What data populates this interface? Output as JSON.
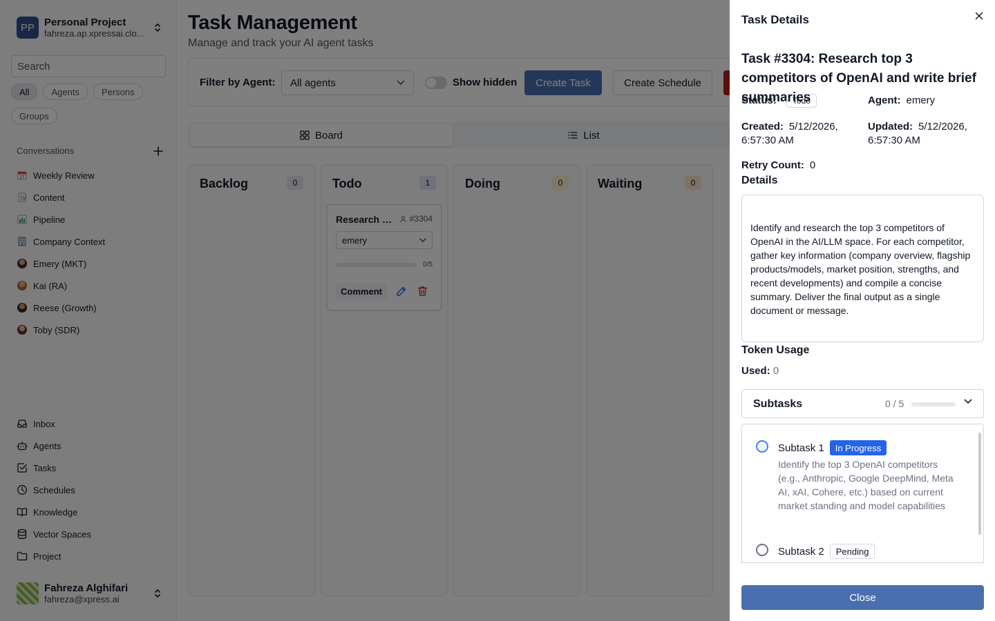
{
  "sidebar": {
    "project": {
      "initials": "PP",
      "name": "Personal Project",
      "email": "fahreza.ap.xpressai.clo..."
    },
    "search_placeholder": "Search",
    "filters": [
      "All",
      "Agents",
      "Persons",
      "Groups"
    ],
    "conversations_label": "Conversations",
    "conversations": [
      {
        "label": "Weekly Review",
        "icon": "calendar-emoji"
      },
      {
        "label": "Content",
        "icon": "memo-emoji"
      },
      {
        "label": "Pipeline",
        "icon": "bar-chart-emoji"
      },
      {
        "label": "Company Context",
        "icon": "office-building-emoji"
      },
      {
        "label": "Emery (MKT)",
        "icon": "avatar"
      },
      {
        "label": "Kai (RA)",
        "icon": "avatar"
      },
      {
        "label": "Reese (Growth)",
        "icon": "avatar"
      },
      {
        "label": "Toby (SDR)",
        "icon": "avatar"
      }
    ],
    "nav": [
      {
        "label": "Inbox",
        "icon": "inbox-icon"
      },
      {
        "label": "Agents",
        "icon": "bot-icon"
      },
      {
        "label": "Tasks",
        "icon": "checkbox-icon"
      },
      {
        "label": "Schedules",
        "icon": "clock-icon"
      },
      {
        "label": "Knowledge",
        "icon": "book-icon"
      },
      {
        "label": "Vector Spaces",
        "icon": "database-icon"
      },
      {
        "label": "Project",
        "icon": "folder-icon"
      }
    ],
    "user": {
      "name": "Fahreza Alghifari",
      "email": "fahreza@xpress.ai"
    }
  },
  "main": {
    "title": "Task Management",
    "subtitle": "Manage and track your AI agent tasks",
    "filter_label": "Filter by Agent:",
    "agent_select": "All agents",
    "show_hidden_label": "Show hidden",
    "create_task_label": "Create Task",
    "create_schedule_label": "Create Schedule",
    "view_tabs": [
      "Board",
      "List"
    ],
    "columns": [
      {
        "title": "Backlog",
        "count": "0",
        "badge_bg": "#e5e7eb"
      },
      {
        "title": "Todo",
        "count": "1",
        "badge_bg": "#dbe4f6"
      },
      {
        "title": "Doing",
        "count": "0",
        "badge_bg": "#fdf2c4"
      },
      {
        "title": "Waiting",
        "count": "0",
        "badge_bg": "#fde7c8"
      }
    ],
    "card": {
      "title": "Research top 3 competitors of OpenAI and write brief summaries",
      "id": "#3304",
      "assignee": "emery",
      "progress": "0/5",
      "progress_fraction": 0,
      "comment_label": "Comment"
    }
  },
  "drawer": {
    "title": "Task Details",
    "task_heading": "Task #3304: Research top 3 competitors of OpenAI and write brief summaries",
    "status_label": "Status:",
    "status_value": "Todo",
    "agent_label": "Agent:",
    "agent_value": "emery",
    "created_label": "Created:",
    "created_value": "5/12/2026, 6:57:30 AM",
    "updated_label": "Updated:",
    "updated_value": "5/12/2026, 6:57:30 AM",
    "retry_label": "Retry Count:",
    "retry_value": "0",
    "details_heading": "Details",
    "details_text": "Identify and research the top 3 competitors of OpenAI in the AI/LLM space. For each competitor, gather key information (company overview, flagship products/models, market position, strengths, and recent developments) and compile a concise summary. Deliver the final output as a single document or message.",
    "token_heading": "Token Usage",
    "used_label": "Used:",
    "used_value": "0",
    "subtasks_label": "Subtasks",
    "subtasks_count": "0 / 5",
    "subtasks_fraction": 0,
    "subtasks": [
      {
        "name": "Subtask 1",
        "status": "In Progress",
        "description": "Identify the top 3 OpenAI competitors (e.g., Anthropic, Google DeepMind, Meta AI, xAI, Cohere, etc.) based on current market standing and model capabilities"
      },
      {
        "name": "Subtask 2",
        "status": "Pending",
        "description": ""
      }
    ],
    "close_label": "Close"
  },
  "colors": {
    "primary": "#4a6fb0",
    "danger": "#b91c1c",
    "in_progress": "#2563eb"
  }
}
